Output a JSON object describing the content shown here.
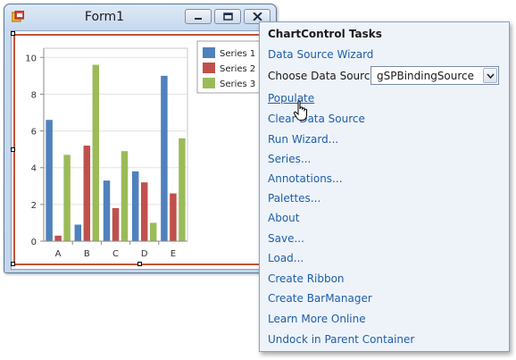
{
  "form": {
    "title": "Form1",
    "icon": "form-app-icon",
    "buttons": [
      "minimize-icon",
      "maximize-icon",
      "close-icon"
    ]
  },
  "chart_data": {
    "type": "bar",
    "categories": [
      "A",
      "B",
      "C",
      "D",
      "E"
    ],
    "series": [
      {
        "name": "Series 1",
        "color": "#4f81bd",
        "values": [
          6.6,
          0.9,
          3.3,
          3.8,
          9.0
        ]
      },
      {
        "name": "Series 2",
        "color": "#c0504d",
        "values": [
          0.3,
          5.2,
          1.8,
          3.2,
          2.6
        ]
      },
      {
        "name": "Series 3",
        "color": "#9bbb59",
        "values": [
          4.7,
          9.6,
          4.9,
          1.0,
          5.6
        ]
      }
    ],
    "yticks": [
      "0",
      "2",
      "4",
      "6",
      "8",
      "10"
    ],
    "ylim": [
      0,
      10.5
    ],
    "grid": true,
    "legend": "top-right"
  },
  "tasks": {
    "title": "ChartControl Tasks",
    "data_source_wizard": "Data Source Wizard",
    "choose_data_source_label": "Choose Data Source",
    "data_source_value": "gSPBindingSource",
    "items": [
      "Populate",
      "Clear Data Source",
      "Run Wizard...",
      "Series...",
      "Annotations...",
      "Palettes...",
      "About",
      "Save...",
      "Load...",
      "Create Ribbon",
      "Create BarManager",
      "Learn More Online",
      "Undock in Parent Container"
    ]
  }
}
